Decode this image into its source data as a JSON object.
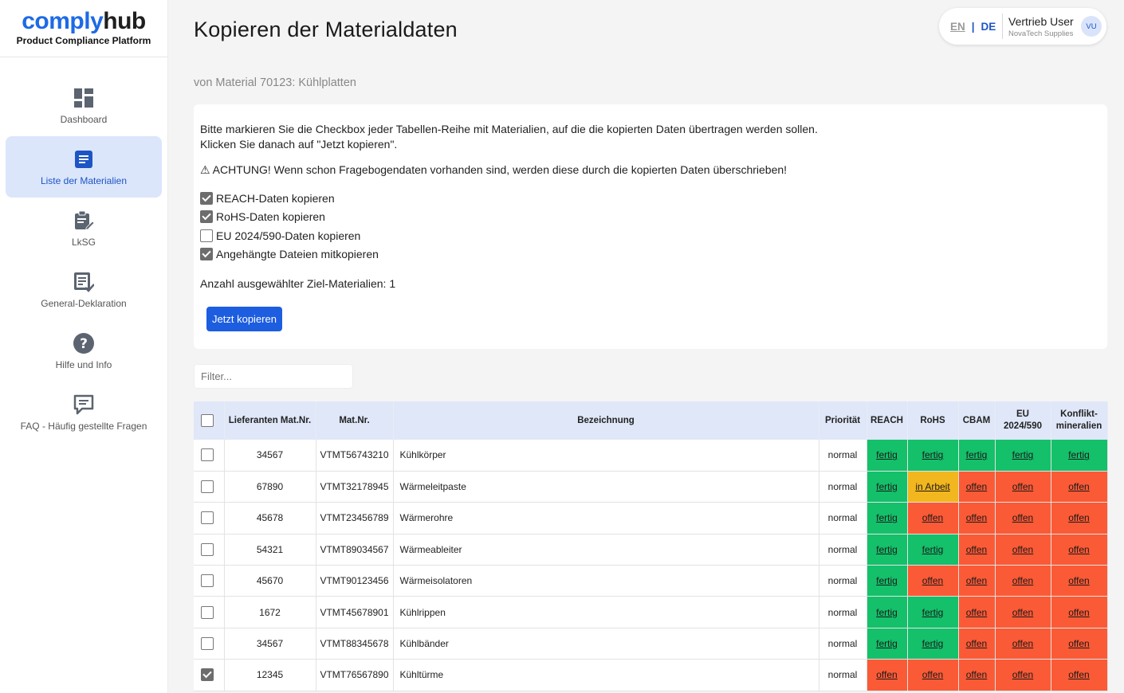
{
  "brand": {
    "name_part1": "comply",
    "name_part2": "hub",
    "tagline": "Product Compliance Platform"
  },
  "sidebar": {
    "items": [
      {
        "label": "Dashboard",
        "icon": "dashboard-icon",
        "active": false
      },
      {
        "label": "Liste der Materialien",
        "icon": "document-list-icon",
        "active": true
      },
      {
        "label": "LkSG",
        "icon": "clipboard-edit-icon",
        "active": false
      },
      {
        "label": "General-Deklaration",
        "icon": "declaration-icon",
        "active": false
      },
      {
        "label": "Hilfe und Info",
        "icon": "help-icon",
        "active": false
      },
      {
        "label": "FAQ - Häufig gestellte Fragen",
        "icon": "faq-icon",
        "active": false
      }
    ]
  },
  "header": {
    "title": "Kopieren der Materialdaten",
    "subtitle": "von Material 70123: Kühlplatten",
    "lang_en": "EN",
    "lang_sep": "|",
    "lang_de": "DE",
    "user_name": "Vertrieb User",
    "user_org": "NovaTech Supplies",
    "avatar": "VU"
  },
  "info": {
    "line1": "Bitte markieren Sie die Checkbox jeder Tabellen-Reihe mit Materialien, auf die die kopierten Daten übertragen werden sollen.",
    "line2": "Klicken Sie danach auf \"Jetzt kopieren\".",
    "warning": "⚠ ACHTUNG! Wenn schon Fragebogendaten vorhanden sind, werden diese durch die kopierten Daten überschrieben!",
    "options": [
      {
        "label": "REACH-Daten kopieren",
        "checked": true
      },
      {
        "label": "RoHS-Daten kopieren",
        "checked": true
      },
      {
        "label": "EU 2024/590-Daten kopieren",
        "checked": false
      },
      {
        "label": "Angehängte Dateien mitkopieren",
        "checked": true
      }
    ],
    "count_text": "Anzahl ausgewählter Ziel-Materialien: 1",
    "copy_button": "Jetzt kopieren"
  },
  "filter": {
    "placeholder": "Filter..."
  },
  "table": {
    "headers": {
      "lief": "Lieferanten Mat.Nr.",
      "mat": "Mat.Nr.",
      "bez": "Bezeichnung",
      "prio": "Priorität",
      "reach": "REACH",
      "rohs": "RoHS",
      "cbam": "CBAM",
      "eu1": "EU",
      "eu2": "2024/590",
      "konf1": "Konflikt-",
      "konf2": "mineralien"
    },
    "status_colors": {
      "fertig": "#14c06a",
      "in Arbeit": "#f2b61f",
      "offen": "#fb5a36"
    },
    "rows": [
      {
        "checked": false,
        "lief": "34567",
        "mat": "VTMT56743210",
        "bez": "Kühlkörper",
        "prio": "normal",
        "st": [
          "fertig",
          "fertig",
          "fertig",
          "fertig",
          "fertig"
        ]
      },
      {
        "checked": false,
        "lief": "67890",
        "mat": "VTMT32178945",
        "bez": "Wärmeleitpaste",
        "prio": "normal",
        "st": [
          "fertig",
          "in Arbeit",
          "offen",
          "offen",
          "offen"
        ]
      },
      {
        "checked": false,
        "lief": "45678",
        "mat": "VTMT23456789",
        "bez": "Wärmerohre",
        "prio": "normal",
        "st": [
          "fertig",
          "offen",
          "offen",
          "offen",
          "offen"
        ]
      },
      {
        "checked": false,
        "lief": "54321",
        "mat": "VTMT89034567",
        "bez": "Wärmeableiter",
        "prio": "normal",
        "st": [
          "fertig",
          "fertig",
          "offen",
          "offen",
          "offen"
        ]
      },
      {
        "checked": false,
        "lief": "45670",
        "mat": "VTMT90123456",
        "bez": "Wärmeisolatoren",
        "prio": "normal",
        "st": [
          "fertig",
          "offen",
          "offen",
          "offen",
          "offen"
        ]
      },
      {
        "checked": false,
        "lief": "1672",
        "mat": "VTMT45678901",
        "bez": "Kühlrippen",
        "prio": "normal",
        "st": [
          "fertig",
          "fertig",
          "offen",
          "offen",
          "offen"
        ]
      },
      {
        "checked": false,
        "lief": "34567",
        "mat": "VTMT88345678",
        "bez": "Kühlbänder",
        "prio": "normal",
        "st": [
          "fertig",
          "fertig",
          "offen",
          "offen",
          "offen"
        ]
      },
      {
        "checked": true,
        "lief": "12345",
        "mat": "VTMT76567890",
        "bez": "Kühltürme",
        "prio": "normal",
        "st": [
          "offen",
          "offen",
          "offen",
          "offen",
          "offen"
        ]
      }
    ]
  }
}
